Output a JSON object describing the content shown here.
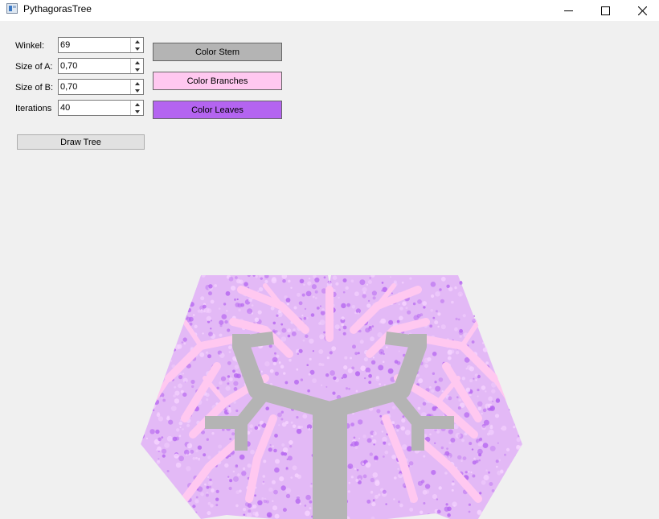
{
  "window": {
    "title": "PythagorasTree",
    "minimize_icon": "minimize-icon",
    "maximize_icon": "maximize-icon",
    "close_icon": "close-icon"
  },
  "controls": {
    "winkel": {
      "label": "Winkel:",
      "value": "69"
    },
    "size_a": {
      "label": "Size of A:",
      "value": "0,70"
    },
    "size_b": {
      "label": "Size of B:",
      "value": "0,70"
    },
    "iterations": {
      "label": "Iterations",
      "value": "40"
    },
    "draw_button": "Draw Tree"
  },
  "color_buttons": {
    "stem": {
      "label": "Color Stem",
      "color": "#b4b4b4"
    },
    "branches": {
      "label": "Color Branches",
      "color": "#ffc8f0"
    },
    "leaves": {
      "label": "Color Leaves",
      "color": "#b464f0"
    }
  },
  "tree": {
    "stem_color": "#b4b4b4",
    "branch_color": "#ffc8f0",
    "leaf_color": "#b464f0"
  }
}
